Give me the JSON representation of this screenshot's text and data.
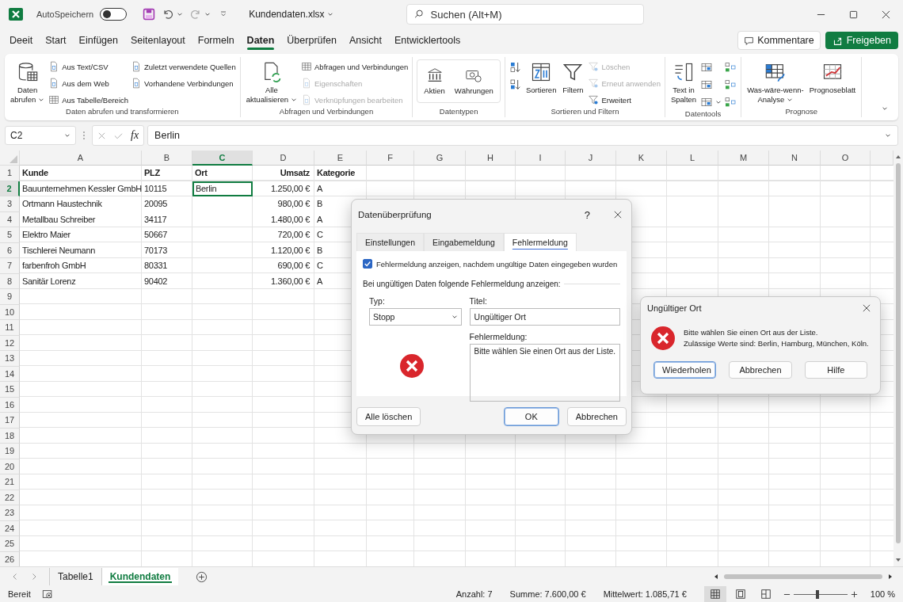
{
  "title_bar": {
    "autosave_label": "AutoSpeichern",
    "autosave_on": false,
    "filename": "Kundendaten.xlsx",
    "search": {
      "placeholder": "Suchen (Alt+M)"
    }
  },
  "tabs": [
    {
      "label": "Deeit",
      "selected": false
    },
    {
      "label": "Start",
      "selected": false
    },
    {
      "label": "Einfügen",
      "selected": false
    },
    {
      "label": "Seitenlayout",
      "selected": false
    },
    {
      "label": "Formeln",
      "selected": false
    },
    {
      "label": "Daten",
      "selected": true
    },
    {
      "label": "Überprüfen",
      "selected": false
    },
    {
      "label": "Ansicht",
      "selected": false
    },
    {
      "label": "Entwicklertools",
      "selected": false
    }
  ],
  "header_buttons": {
    "comments": "Kommentare",
    "share": "Freigeben"
  },
  "ribbon_groups": [
    {
      "columns": [
        {
          "kind": "large",
          "lines": [
            "Daten",
            "abrufen"
          ],
          "dropdown": true
        },
        {
          "kind": "stack",
          "items": [
            {
              "label": "Aus Text/CSV",
              "disabled": false
            },
            {
              "label": "Aus dem Web",
              "disabled": false
            },
            {
              "label": "Aus Tabelle/Bereich",
              "disabled": false
            }
          ]
        },
        {
          "kind": "stack",
          "items": [
            {
              "label": "Zuletzt verwendete Quellen",
              "disabled": false
            },
            {
              "label": "Vorhandene Verbindungen",
              "disabled": false
            }
          ]
        }
      ],
      "label": "Daten abrufen und transformieren"
    },
    {
      "columns": [
        {
          "kind": "large",
          "lines": [
            "Alle",
            "aktualisieren"
          ],
          "dropdown": true
        },
        {
          "kind": "stack",
          "items": [
            {
              "label": "Abfragen und Verbindungen",
              "disabled": false
            },
            {
              "label": "Eigenschaften",
              "disabled": true
            },
            {
              "label": "Verknüpfungen bearbeiten",
              "disabled": true
            }
          ]
        }
      ],
      "label": "Abfragen und Verbindungen"
    },
    {
      "columns": [
        {
          "kind": "gallery",
          "items": [
            {
              "lines": [
                "Aktien"
              ],
              "dropdown": false
            },
            {
              "lines": [
                "Währungen"
              ],
              "dropdown": false
            }
          ]
        }
      ],
      "label": "Datentypen"
    },
    {
      "columns": [
        {
          "kind": "icons",
          "items": [
            {
              "dropdown": false
            },
            {
              "dropdown": false
            }
          ]
        },
        {
          "kind": "large",
          "lines": [
            "Sortieren"
          ],
          "dropdown": false
        },
        {
          "kind": "large",
          "lines": [
            "Filtern"
          ],
          "dropdown": false
        },
        {
          "kind": "stack",
          "items": [
            {
              "label": "Löschen",
              "disabled": true
            },
            {
              "label": "Erneut anwenden",
              "disabled": true
            },
            {
              "label": "Erweitert",
              "disabled": false
            }
          ]
        }
      ],
      "label": "Sortieren und Filtern"
    },
    {
      "columns": [
        {
          "kind": "large",
          "lines": [
            "Text in",
            "Spalten"
          ],
          "dropdown": false
        },
        {
          "kind": "icons",
          "items": [
            {
              "dropdown": false
            },
            {
              "dropdown": false
            },
            {
              "dropdown": true
            }
          ]
        },
        {
          "kind": "icons",
          "items": [
            {
              "dropdown": false
            },
            {
              "dropdown": false
            },
            {
              "dropdown": false
            }
          ]
        }
      ],
      "label": "Datentools"
    },
    {
      "columns": [
        {
          "kind": "large",
          "lines": [
            "Was-wäre-wenn-",
            "Analyse"
          ],
          "dropdown": true
        },
        {
          "kind": "large",
          "lines": [
            "Prognoseblatt"
          ],
          "dropdown": false
        }
      ],
      "label": "Prognose"
    }
  ],
  "formula_bar": {
    "name_box": "C2",
    "function_label": "fx",
    "formula": "Berlin"
  },
  "columns": [
    {
      "label": "A",
      "selected": false,
      "right_aligned": false
    },
    {
      "label": "B",
      "selected": false,
      "right_aligned": false
    },
    {
      "label": "C",
      "selected": true,
      "right_aligned": false
    },
    {
      "label": "D",
      "selected": false,
      "right_aligned": true
    },
    {
      "label": "E",
      "selected": false,
      "right_aligned": false
    },
    {
      "label": "F",
      "selected": false
    },
    {
      "label": "G",
      "selected": false
    },
    {
      "label": "H",
      "selected": false
    },
    {
      "label": "I",
      "selected": false
    },
    {
      "label": "J",
      "selected": false
    },
    {
      "label": "K",
      "selected": false
    },
    {
      "label": "L",
      "selected": false
    },
    {
      "label": "M",
      "selected": false
    },
    {
      "label": "N",
      "selected": false
    },
    {
      "label": "O",
      "selected": false
    }
  ],
  "rows": [
    {
      "label": "1",
      "selected": false,
      "bold": true,
      "cells": {
        "A": "Kunde",
        "B": "PLZ",
        "C": "Ort",
        "D": "Umsatz",
        "E": "Kategorie"
      }
    },
    {
      "label": "2",
      "selected": true,
      "bold": false,
      "cells": {
        "A": "Bauunternehmen Kessler GmbH",
        "B": "10115",
        "C": "Berlin",
        "D": "1.250,00 €",
        "E": "A"
      }
    },
    {
      "label": "3",
      "selected": false,
      "bold": false,
      "cells": {
        "A": "Ortmann Haustechnik",
        "B": "20095",
        "D": "980,00 €",
        "E": "B"
      }
    },
    {
      "label": "4",
      "selected": false,
      "bold": false,
      "cells": {
        "A": "Metallbau Schreiber",
        "B": "34117",
        "D": "1.480,00 €",
        "E": "A"
      }
    },
    {
      "label": "5",
      "selected": false,
      "bold": false,
      "cells": {
        "A": "Elektro Maier",
        "B": "50667",
        "D": "720,00 €",
        "E": "C"
      }
    },
    {
      "label": "6",
      "selected": false,
      "bold": false,
      "cells": {
        "A": "Tischlerei Neumann",
        "B": "70173",
        "D": "1.120,00 €",
        "E": "B"
      }
    },
    {
      "label": "7",
      "selected": false,
      "bold": false,
      "cells": {
        "A": "farbenfroh GmbH",
        "B": "80331",
        "D": "690,00 €",
        "E": "C"
      }
    },
    {
      "label": "8",
      "selected": false,
      "bold": false,
      "cells": {
        "A": "Sanitär Lorenz",
        "B": "90402",
        "D": "1.360,00 €",
        "E": "A"
      }
    },
    {
      "label": "9",
      "selected": false
    },
    {
      "label": "10",
      "selected": false
    },
    {
      "label": "11",
      "selected": false
    },
    {
      "label": "12",
      "selected": false
    },
    {
      "label": "13",
      "selected": false
    },
    {
      "label": "14",
      "selected": false
    },
    {
      "label": "15",
      "selected": false
    },
    {
      "label": "16",
      "selected": false
    },
    {
      "label": "17",
      "selected": false
    },
    {
      "label": "18",
      "selected": false
    },
    {
      "label": "19",
      "selected": false
    },
    {
      "label": "20",
      "selected": false
    },
    {
      "label": "21",
      "selected": false
    },
    {
      "label": "22",
      "selected": false
    },
    {
      "label": "23",
      "selected": false
    },
    {
      "label": "24",
      "selected": false
    },
    {
      "label": "25",
      "selected": false
    },
    {
      "label": "26",
      "selected": false
    }
  ],
  "sheet_tabs": [
    {
      "label": "Tabelle1",
      "selected": false
    },
    {
      "label": "Kundendaten",
      "selected": true
    }
  ],
  "status_bar": {
    "mode": "Bereit",
    "stats": [
      "Anzahl: 7",
      "Summe: 7.600,00 €",
      "Mittelwert: 1.085,71 €"
    ],
    "views": [
      {
        "selected": true
      },
      {
        "selected": false
      },
      {
        "selected": false
      }
    ],
    "zoom": {
      "level": 0.45,
      "label": "100 %"
    }
  },
  "validation_dialog": {
    "title": "Datenüberprüfung",
    "help": "?",
    "tabs": [
      {
        "label": "Einstellungen",
        "selected": false
      },
      {
        "label": "Eingabemeldung",
        "selected": false
      },
      {
        "label": "Fehlermeldung",
        "selected": true
      }
    ],
    "checkbox": {
      "label": "Fehlermeldung anzeigen, nachdem ungültige Daten eingegeben wurden",
      "checked": true
    },
    "section": "Bei ungültigen Daten folgende Fehlermeldung anzeigen:",
    "type_label": "Typ:",
    "type_value": "Stopp",
    "title_label": "Titel:",
    "title_value": "Ungültiger Ort",
    "message_label": "Fehlermeldung:",
    "message_value": "Bitte wählen Sie einen Ort aus der Liste.",
    "buttons": [
      {
        "label": "Alle löschen",
        "default": false
      },
      {
        "label": "OK",
        "default": true
      },
      {
        "label": "Abbrechen",
        "default": false
      }
    ]
  },
  "error_dialog": {
    "title": "Ungültiger Ort",
    "lines": [
      "Bitte wählen Sie einen Ort aus der Liste.",
      "Zulässige Werte sind: Berlin, Hamburg, München, Köln."
    ],
    "buttons": [
      {
        "label": "Wiederholen",
        "default": true
      },
      {
        "label": "Abbrechen",
        "default": false
      },
      {
        "label": "Hilfe",
        "default": false
      }
    ]
  }
}
